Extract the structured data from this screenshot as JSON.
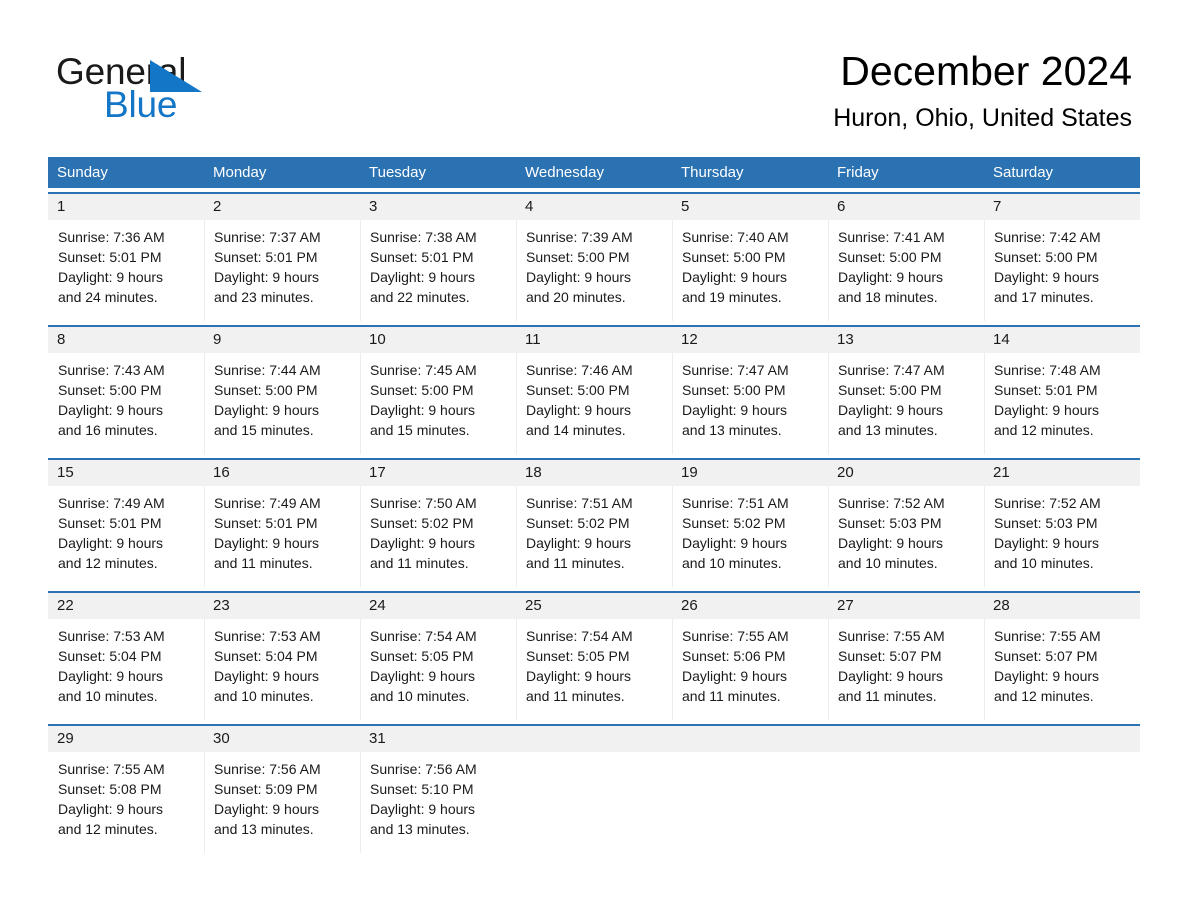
{
  "brand": {
    "name_part1": "General",
    "name_part2": "Blue",
    "triangle_color": "#1476c6",
    "text_color": "#1a1a1a"
  },
  "header": {
    "title": "December 2024",
    "subtitle": "Huron, Ohio, United States"
  },
  "theme": {
    "header_blue": "#2b72b3",
    "daynum_band": "#f1f1f1",
    "cell_background": "#ffffff",
    "page_background": "#ffffff"
  },
  "weekdays": [
    "Sunday",
    "Monday",
    "Tuesday",
    "Wednesday",
    "Thursday",
    "Friday",
    "Saturday"
  ],
  "weeks": [
    {
      "days": [
        {
          "num": "1",
          "sunrise": "Sunrise: 7:36 AM",
          "sunset": "Sunset: 5:01 PM",
          "daylight_line1": "Daylight: 9 hours",
          "daylight_line2": "and 24 minutes."
        },
        {
          "num": "2",
          "sunrise": "Sunrise: 7:37 AM",
          "sunset": "Sunset: 5:01 PM",
          "daylight_line1": "Daylight: 9 hours",
          "daylight_line2": "and 23 minutes."
        },
        {
          "num": "3",
          "sunrise": "Sunrise: 7:38 AM",
          "sunset": "Sunset: 5:01 PM",
          "daylight_line1": "Daylight: 9 hours",
          "daylight_line2": "and 22 minutes."
        },
        {
          "num": "4",
          "sunrise": "Sunrise: 7:39 AM",
          "sunset": "Sunset: 5:00 PM",
          "daylight_line1": "Daylight: 9 hours",
          "daylight_line2": "and 20 minutes."
        },
        {
          "num": "5",
          "sunrise": "Sunrise: 7:40 AM",
          "sunset": "Sunset: 5:00 PM",
          "daylight_line1": "Daylight: 9 hours",
          "daylight_line2": "and 19 minutes."
        },
        {
          "num": "6",
          "sunrise": "Sunrise: 7:41 AM",
          "sunset": "Sunset: 5:00 PM",
          "daylight_line1": "Daylight: 9 hours",
          "daylight_line2": "and 18 minutes."
        },
        {
          "num": "7",
          "sunrise": "Sunrise: 7:42 AM",
          "sunset": "Sunset: 5:00 PM",
          "daylight_line1": "Daylight: 9 hours",
          "daylight_line2": "and 17 minutes."
        }
      ]
    },
    {
      "days": [
        {
          "num": "8",
          "sunrise": "Sunrise: 7:43 AM",
          "sunset": "Sunset: 5:00 PM",
          "daylight_line1": "Daylight: 9 hours",
          "daylight_line2": "and 16 minutes."
        },
        {
          "num": "9",
          "sunrise": "Sunrise: 7:44 AM",
          "sunset": "Sunset: 5:00 PM",
          "daylight_line1": "Daylight: 9 hours",
          "daylight_line2": "and 15 minutes."
        },
        {
          "num": "10",
          "sunrise": "Sunrise: 7:45 AM",
          "sunset": "Sunset: 5:00 PM",
          "daylight_line1": "Daylight: 9 hours",
          "daylight_line2": "and 15 minutes."
        },
        {
          "num": "11",
          "sunrise": "Sunrise: 7:46 AM",
          "sunset": "Sunset: 5:00 PM",
          "daylight_line1": "Daylight: 9 hours",
          "daylight_line2": "and 14 minutes."
        },
        {
          "num": "12",
          "sunrise": "Sunrise: 7:47 AM",
          "sunset": "Sunset: 5:00 PM",
          "daylight_line1": "Daylight: 9 hours",
          "daylight_line2": "and 13 minutes."
        },
        {
          "num": "13",
          "sunrise": "Sunrise: 7:47 AM",
          "sunset": "Sunset: 5:00 PM",
          "daylight_line1": "Daylight: 9 hours",
          "daylight_line2": "and 13 minutes."
        },
        {
          "num": "14",
          "sunrise": "Sunrise: 7:48 AM",
          "sunset": "Sunset: 5:01 PM",
          "daylight_line1": "Daylight: 9 hours",
          "daylight_line2": "and 12 minutes."
        }
      ]
    },
    {
      "days": [
        {
          "num": "15",
          "sunrise": "Sunrise: 7:49 AM",
          "sunset": "Sunset: 5:01 PM",
          "daylight_line1": "Daylight: 9 hours",
          "daylight_line2": "and 12 minutes."
        },
        {
          "num": "16",
          "sunrise": "Sunrise: 7:49 AM",
          "sunset": "Sunset: 5:01 PM",
          "daylight_line1": "Daylight: 9 hours",
          "daylight_line2": "and 11 minutes."
        },
        {
          "num": "17",
          "sunrise": "Sunrise: 7:50 AM",
          "sunset": "Sunset: 5:02 PM",
          "daylight_line1": "Daylight: 9 hours",
          "daylight_line2": "and 11 minutes."
        },
        {
          "num": "18",
          "sunrise": "Sunrise: 7:51 AM",
          "sunset": "Sunset: 5:02 PM",
          "daylight_line1": "Daylight: 9 hours",
          "daylight_line2": "and 11 minutes."
        },
        {
          "num": "19",
          "sunrise": "Sunrise: 7:51 AM",
          "sunset": "Sunset: 5:02 PM",
          "daylight_line1": "Daylight: 9 hours",
          "daylight_line2": "and 10 minutes."
        },
        {
          "num": "20",
          "sunrise": "Sunrise: 7:52 AM",
          "sunset": "Sunset: 5:03 PM",
          "daylight_line1": "Daylight: 9 hours",
          "daylight_line2": "and 10 minutes."
        },
        {
          "num": "21",
          "sunrise": "Sunrise: 7:52 AM",
          "sunset": "Sunset: 5:03 PM",
          "daylight_line1": "Daylight: 9 hours",
          "daylight_line2": "and 10 minutes."
        }
      ]
    },
    {
      "days": [
        {
          "num": "22",
          "sunrise": "Sunrise: 7:53 AM",
          "sunset": "Sunset: 5:04 PM",
          "daylight_line1": "Daylight: 9 hours",
          "daylight_line2": "and 10 minutes."
        },
        {
          "num": "23",
          "sunrise": "Sunrise: 7:53 AM",
          "sunset": "Sunset: 5:04 PM",
          "daylight_line1": "Daylight: 9 hours",
          "daylight_line2": "and 10 minutes."
        },
        {
          "num": "24",
          "sunrise": "Sunrise: 7:54 AM",
          "sunset": "Sunset: 5:05 PM",
          "daylight_line1": "Daylight: 9 hours",
          "daylight_line2": "and 10 minutes."
        },
        {
          "num": "25",
          "sunrise": "Sunrise: 7:54 AM",
          "sunset": "Sunset: 5:05 PM",
          "daylight_line1": "Daylight: 9 hours",
          "daylight_line2": "and 11 minutes."
        },
        {
          "num": "26",
          "sunrise": "Sunrise: 7:55 AM",
          "sunset": "Sunset: 5:06 PM",
          "daylight_line1": "Daylight: 9 hours",
          "daylight_line2": "and 11 minutes."
        },
        {
          "num": "27",
          "sunrise": "Sunrise: 7:55 AM",
          "sunset": "Sunset: 5:07 PM",
          "daylight_line1": "Daylight: 9 hours",
          "daylight_line2": "and 11 minutes."
        },
        {
          "num": "28",
          "sunrise": "Sunrise: 7:55 AM",
          "sunset": "Sunset: 5:07 PM",
          "daylight_line1": "Daylight: 9 hours",
          "daylight_line2": "and 12 minutes."
        }
      ]
    },
    {
      "days": [
        {
          "num": "29",
          "sunrise": "Sunrise: 7:55 AM",
          "sunset": "Sunset: 5:08 PM",
          "daylight_line1": "Daylight: 9 hours",
          "daylight_line2": "and 12 minutes."
        },
        {
          "num": "30",
          "sunrise": "Sunrise: 7:56 AM",
          "sunset": "Sunset: 5:09 PM",
          "daylight_line1": "Daylight: 9 hours",
          "daylight_line2": "and 13 minutes."
        },
        {
          "num": "31",
          "sunrise": "Sunrise: 7:56 AM",
          "sunset": "Sunset: 5:10 PM",
          "daylight_line1": "Daylight: 9 hours",
          "daylight_line2": "and 13 minutes."
        },
        {
          "num": "",
          "sunrise": "",
          "sunset": "",
          "daylight_line1": "",
          "daylight_line2": ""
        },
        {
          "num": "",
          "sunrise": "",
          "sunset": "",
          "daylight_line1": "",
          "daylight_line2": ""
        },
        {
          "num": "",
          "sunrise": "",
          "sunset": "",
          "daylight_line1": "",
          "daylight_line2": ""
        },
        {
          "num": "",
          "sunrise": "",
          "sunset": "",
          "daylight_line1": "",
          "daylight_line2": ""
        }
      ]
    }
  ]
}
